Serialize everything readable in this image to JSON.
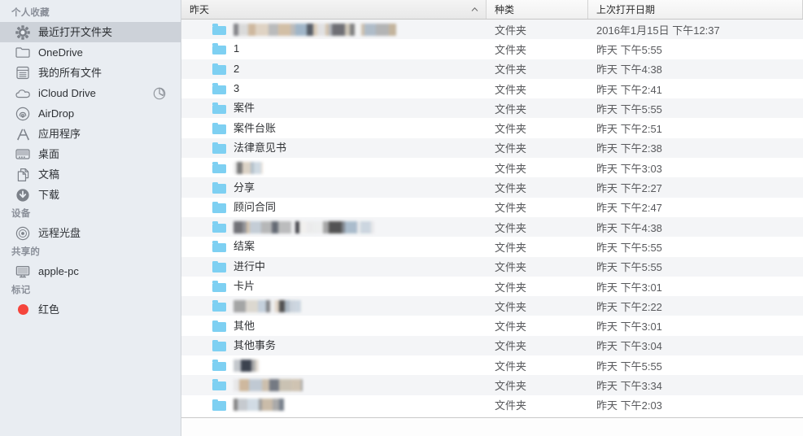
{
  "sidebar": {
    "sections": [
      {
        "title": "个人收藏",
        "items": [
          {
            "label": "最近打开文件夹",
            "icon": "gear-icon",
            "selected": true
          },
          {
            "label": "OneDrive",
            "icon": "folder-icon",
            "selected": false
          },
          {
            "label": "我的所有文件",
            "icon": "all-files-icon",
            "selected": false
          },
          {
            "label": "iCloud Drive",
            "icon": "cloud-icon",
            "selected": false,
            "badge": "progress-pie-icon"
          },
          {
            "label": "AirDrop",
            "icon": "airdrop-icon",
            "selected": false
          },
          {
            "label": "应用程序",
            "icon": "applications-icon",
            "selected": false
          },
          {
            "label": "桌面",
            "icon": "desktop-icon",
            "selected": false
          },
          {
            "label": "文稿",
            "icon": "documents-icon",
            "selected": false
          },
          {
            "label": "下载",
            "icon": "downloads-icon",
            "selected": false
          }
        ]
      },
      {
        "title": "设备",
        "items": [
          {
            "label": "远程光盘",
            "icon": "disc-icon",
            "selected": false
          }
        ]
      },
      {
        "title": "共享的",
        "items": [
          {
            "label": "apple-pc",
            "icon": "computer-icon",
            "selected": false
          }
        ]
      },
      {
        "title": "标记",
        "items": [
          {
            "label": "红色",
            "icon": "tag-dot-icon",
            "color": "#f5453c",
            "selected": false
          }
        ]
      }
    ]
  },
  "columns": [
    {
      "label": "昨天",
      "sorted": true,
      "sort_direction": "asc"
    },
    {
      "label": "种类",
      "sorted": false
    },
    {
      "label": "上次打开日期",
      "sorted": false
    }
  ],
  "colors": {
    "folder": "#7ed0f2",
    "sidebar_bg": "#e9edf2",
    "selection": "#cdd2d9",
    "row_alt": "#f4f5f7",
    "tag_red": "#f5453c"
  },
  "rows": [
    {
      "name": "",
      "redacted": true,
      "redact_w": 200,
      "kind": "文件夹",
      "date": "2016年1月15日 下午12:37"
    },
    {
      "name": "1",
      "redacted": false,
      "kind": "文件夹",
      "date": "昨天 下午5:55"
    },
    {
      "name": "2",
      "redacted": false,
      "kind": "文件夹",
      "date": "昨天 下午4:38"
    },
    {
      "name": "3",
      "redacted": false,
      "kind": "文件夹",
      "date": "昨天 下午2:41"
    },
    {
      "name": "案件",
      "redacted": false,
      "kind": "文件夹",
      "date": "昨天 下午5:55"
    },
    {
      "name": "案件台账",
      "redacted": false,
      "kind": "文件夹",
      "date": "昨天 下午2:51"
    },
    {
      "name": "法律意见书",
      "redacted": false,
      "kind": "文件夹",
      "date": "昨天 下午2:38"
    },
    {
      "name": "",
      "redacted": true,
      "redact_w": 36,
      "kind": "文件夹",
      "date": "昨天 下午3:03"
    },
    {
      "name": "分享",
      "redacted": false,
      "kind": "文件夹",
      "date": "昨天 下午2:27"
    },
    {
      "name": "顾问合同",
      "redacted": false,
      "kind": "文件夹",
      "date": "昨天 下午2:47"
    },
    {
      "name": "",
      "redacted": true,
      "redact_w": 173,
      "kind": "文件夹",
      "date": "昨天 下午4:38"
    },
    {
      "name": "结案",
      "redacted": false,
      "kind": "文件夹",
      "date": "昨天 下午5:55"
    },
    {
      "name": "进行中",
      "redacted": false,
      "kind": "文件夹",
      "date": "昨天 下午5:55"
    },
    {
      "name": "卡片",
      "redacted": false,
      "kind": "文件夹",
      "date": "昨天 下午3:01"
    },
    {
      "name": "",
      "redacted": true,
      "redact_w": 83,
      "kind": "文件夹",
      "date": "昨天 下午2:22"
    },
    {
      "name": "其他",
      "redacted": false,
      "kind": "文件夹",
      "date": "昨天 下午3:01"
    },
    {
      "name": "其他事务",
      "redacted": false,
      "kind": "文件夹",
      "date": "昨天 下午3:04"
    },
    {
      "name": "",
      "redacted": true,
      "redact_w": 31,
      "kind": "文件夹",
      "date": "昨天 下午5:55"
    },
    {
      "name": "",
      "redacted": true,
      "redact_w": 85,
      "kind": "文件夹",
      "date": "昨天 下午3:34"
    },
    {
      "name": "",
      "redacted": true,
      "redact_w": 63,
      "kind": "文件夹",
      "date": "昨天 下午2:03"
    }
  ]
}
